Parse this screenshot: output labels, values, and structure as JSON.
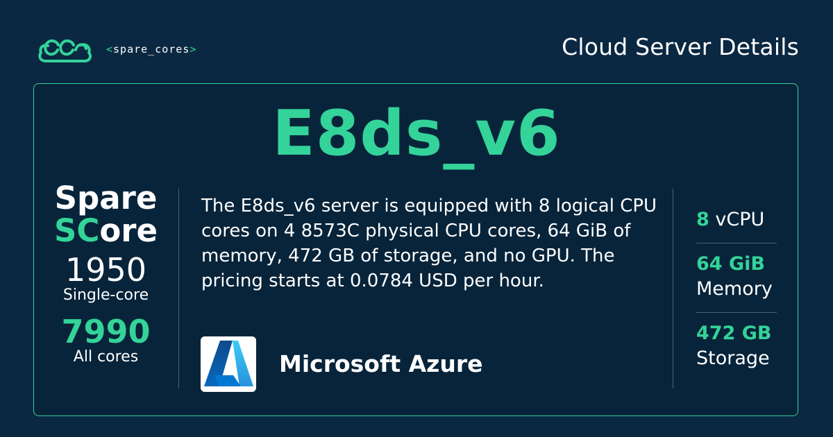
{
  "header": {
    "brand": "spare_cores",
    "brand_open": "<",
    "brand_close": ">",
    "title": "Cloud Server Details"
  },
  "server": {
    "name": "E8ds_v6",
    "description": "The E8ds_v6 server is equipped with 8 logical CPU cores on 4 8573C physical CPU cores, 64 GiB of memory, 472 GB of storage, and no GPU. The pricing starts at 0.0784 USD per hour."
  },
  "score": {
    "title_line1": "Spare",
    "title_accent": "SC",
    "title_rest": "ore",
    "single_core_value": "1950",
    "single_core_label": "Single-core",
    "all_cores_value": "7990",
    "all_cores_label": "All cores"
  },
  "vendor": {
    "name": "Microsoft Azure",
    "logo_icon": "azure-logo-icon"
  },
  "specs": {
    "vcpu_value": "8",
    "vcpu_label": "vCPU",
    "memory_value": "64 GiB",
    "memory_label": "Memory",
    "storage_value": "472 GB",
    "storage_label": "Storage"
  },
  "colors": {
    "background": "#0b2842",
    "card": "#08243a",
    "accent": "#34d399",
    "divider": "#4a6478"
  }
}
